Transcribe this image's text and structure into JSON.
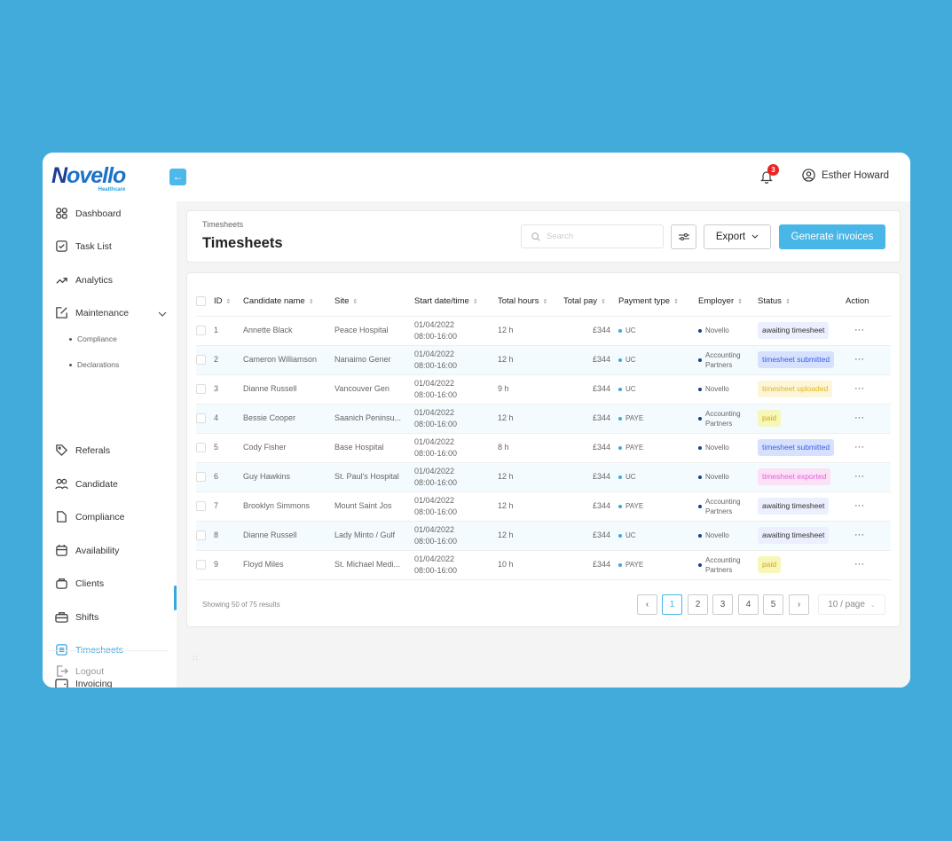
{
  "brand": {
    "name": "Novello",
    "tagline": "Healthcare"
  },
  "sidebar": {
    "items": [
      {
        "label": "Dashboard",
        "icon": "dashboard-icon"
      },
      {
        "label": "Task List",
        "icon": "checkbox-icon"
      },
      {
        "label": "Analytics",
        "icon": "trend-icon"
      },
      {
        "label": "Maintenance",
        "icon": "edit-icon"
      },
      {
        "label": "Referals",
        "icon": "tag-icon"
      },
      {
        "label": "Candidate",
        "icon": "users-icon"
      },
      {
        "label": "Compliance",
        "icon": "document-icon"
      },
      {
        "label": "Availability",
        "icon": "calendar-icon"
      },
      {
        "label": "Clients",
        "icon": "bag-icon"
      },
      {
        "label": "Shifts",
        "icon": "briefcase-icon"
      },
      {
        "label": "Timesheets",
        "icon": "grid-icon",
        "active": true
      },
      {
        "label": "Invoicing",
        "icon": "wallet-icon"
      }
    ],
    "sub_items": [
      "Compliance",
      "Declarations"
    ],
    "logout": "Logout"
  },
  "header": {
    "notifications": "3",
    "user": "Esther Howard"
  },
  "page": {
    "breadcrumb": "Timesheets",
    "title": "Timesheets",
    "search_placeholder": "Search",
    "export": "Export",
    "generate": "Generate invoices"
  },
  "table": {
    "columns": [
      "ID",
      "Candidate name",
      "Site",
      "Start date/time",
      "Total hours",
      "Total pay",
      "Payment type",
      "Employer",
      "Status",
      "Action"
    ],
    "rows": [
      {
        "id": "1",
        "name": "Annette Black",
        "site": "Peace  Hospital",
        "date": "01/04/2022",
        "time": "08:00-16:00",
        "hours": "12 h",
        "pay": "£344",
        "ptype": "UC",
        "employer": "Novello",
        "status": "awaiting timesheet"
      },
      {
        "id": "2",
        "name": "Cameron Williamson",
        "site": "Nanaimo  Gener",
        "date": "01/04/2022",
        "time": "08:00-16:00",
        "hours": "12 h",
        "pay": "£344",
        "ptype": "UC",
        "employer": "Accounting Partners",
        "status": "timesheet submitted"
      },
      {
        "id": "3",
        "name": "Dianne Russell",
        "site": "Vancouver Gen",
        "date": "01/04/2022",
        "time": "08:00-16:00",
        "hours": "9 h",
        "pay": "£344",
        "ptype": "UC",
        "employer": "Novello",
        "status": "timesheet uploaded"
      },
      {
        "id": "4",
        "name": "Bessie Cooper",
        "site": "Saanich Peninsu...",
        "date": "01/04/2022",
        "time": "08:00-16:00",
        "hours": "12 h",
        "pay": "£344",
        "ptype": "PAYE",
        "employer": "Accounting Partners",
        "status": "paid"
      },
      {
        "id": "5",
        "name": "Cody Fisher",
        "site": "Base Hospital",
        "date": "01/04/2022",
        "time": "08:00-16:00",
        "hours": "8 h",
        "pay": "£344",
        "ptype": "PAYE",
        "employer": "Novello",
        "status": "timesheet submitted"
      },
      {
        "id": "6",
        "name": "Guy Hawkins",
        "site": "St. Paul's Hospital",
        "date": "01/04/2022",
        "time": "08:00-16:00",
        "hours": "12 h",
        "pay": "£344",
        "ptype": "UC",
        "employer": "Novello",
        "status": "timesheet exported"
      },
      {
        "id": "7",
        "name": "Brooklyn Simmons",
        "site": "Mount Saint Jos",
        "date": "01/04/2022",
        "time": "08:00-16:00",
        "hours": "12 h",
        "pay": "£344",
        "ptype": "PAYE",
        "employer": "Accounting Partners",
        "status": "awaiting timesheet"
      },
      {
        "id": "8",
        "name": "Dianne Russell",
        "site": "Lady Minto / Gulf",
        "date": "01/04/2022",
        "time": "08:00-16:00",
        "hours": "12 h",
        "pay": "£344",
        "ptype": "UC",
        "employer": "Novello",
        "status": "awaiting timesheet"
      },
      {
        "id": "9",
        "name": "Floyd Miles",
        "site": "St. Michael Medi...",
        "date": "01/04/2022",
        "time": "08:00-16:00",
        "hours": "10 h",
        "pay": "£344",
        "ptype": "PAYE",
        "employer": "Accounting Partners",
        "status": "paid"
      }
    ],
    "action_label": "···"
  },
  "status_colors": {
    "awaiting timesheet": {
      "bg": "#eceffd",
      "fg": "#333333"
    },
    "timesheet submitted": {
      "bg": "#d6e2fd",
      "fg": "#3b5cf0"
    },
    "timesheet uploaded": {
      "bg": "#fdf5d8",
      "fg": "#e0b820"
    },
    "paid": {
      "bg": "#f6f7b8",
      "fg": "#d4a614"
    },
    "timesheet exported": {
      "bg": "#fbe0f6",
      "fg": "#e065d4"
    }
  },
  "colors": {
    "ptype_dot": "#3aa8e0",
    "employer_dot": "#1b3f94",
    "accent": "#48b6e6"
  },
  "pagination": {
    "summary": "Showing 50 of 75 results",
    "pages": [
      "1",
      "2",
      "3",
      "4",
      "5"
    ],
    "current": "1",
    "prev": "‹",
    "next": "›",
    "per_page": "10 / page"
  }
}
